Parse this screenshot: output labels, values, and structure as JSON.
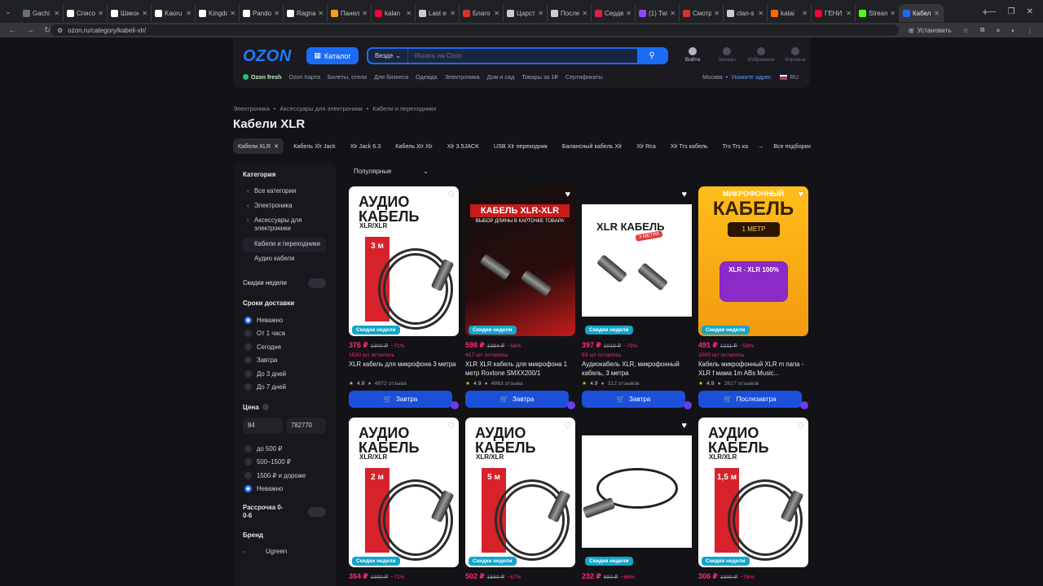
{
  "browser": {
    "tabs": [
      {
        "title": "Gachi",
        "color": "#6a6e7a"
      },
      {
        "title": "Списо",
        "color": "#ffffff"
      },
      {
        "title": "Шикон",
        "color": "#ffffff"
      },
      {
        "title": "Kaoru",
        "color": "#ffffff"
      },
      {
        "title": "Kingdo",
        "color": "#ffffff"
      },
      {
        "title": "Pando",
        "color": "#ffffff"
      },
      {
        "title": "Ragna",
        "color": "#ffffff"
      },
      {
        "title": "Панел",
        "color": "#f4a01c"
      },
      {
        "title": "kalan",
        "color": "#ff0033"
      },
      {
        "title": "Last e",
        "color": "#cccccc"
      },
      {
        "title": "Благо",
        "color": "#d8302f"
      },
      {
        "title": "Царст",
        "color": "#cccccc"
      },
      {
        "title": "После",
        "color": "#cccccc"
      },
      {
        "title": "Серде",
        "color": "#e0204a"
      },
      {
        "title": "(1) Twi",
        "color": "#9146ff"
      },
      {
        "title": "Смотр",
        "color": "#d8302f"
      },
      {
        "title": "clan-s",
        "color": "#cccccc"
      },
      {
        "title": "katai",
        "color": "#ff6a00"
      },
      {
        "title": "ГЕНИ",
        "color": "#ff0033"
      },
      {
        "title": "Stream",
        "color": "#53fc18"
      },
      {
        "title": "Кабел",
        "color": "#1c6bf5",
        "active": true
      }
    ],
    "url": "ozon.ru/category/kabeli-xlr/",
    "install_label": "Установить"
  },
  "header": {
    "logo": "OZON",
    "catalog_label": "Каталог",
    "search_scope": "Везде",
    "search_placeholder": "Искать на Ozon",
    "icons": [
      {
        "label": "Войти",
        "icon": "user-icon",
        "active": true
      },
      {
        "label": "Заказы",
        "icon": "box-icon"
      },
      {
        "label": "Избранное",
        "icon": "heart-icon"
      },
      {
        "label": "Корзина",
        "icon": "cart-icon"
      }
    ],
    "subnav": [
      "Ozon fresh",
      "Ozon Карта",
      "Билеты, отели",
      "Для бизнеса",
      "Одежда",
      "Электроника",
      "Дом и сад",
      "Товары за 1₽",
      "Сертификаты"
    ],
    "city": "Москва",
    "address_link": "Укажите адрес",
    "lang": "RU"
  },
  "breadcrumb": [
    "Электроника",
    "Аксессуары для электроники",
    "Кабели и переходники"
  ],
  "page_title": "Кабели XLR",
  "chips": [
    "Кабели XLR",
    "Кабель Xlr Jack",
    "Xlr Jack 6.3",
    "Кабель Xlr Xlr",
    "Xlr 3.5JACK",
    "USB Xlr переходник",
    "Балансный кабель Xlr",
    "Xlr Rca",
    "Xlr Trs кабель",
    "Trs Trs ка",
    "Все подборки"
  ],
  "sidebar": {
    "category_title": "Категория",
    "categories": [
      "Все категории",
      "Электроника",
      "Аксессуары для электроники",
      "Кабели и переходники",
      "Аудио кабели"
    ],
    "week_deals": "Скидки недели",
    "delivery_title": "Сроки доставки",
    "delivery": [
      "Неважно",
      "От 1 часа",
      "Сегодня",
      "Завтра",
      "До 3 дней",
      "До 7 дней"
    ],
    "price_title": "Цена",
    "price_from": "84",
    "price_to": "782770",
    "price_ranges": [
      "до 500 ₽",
      "500–1500 ₽",
      "1500 ₽ и дороже",
      "Неважно"
    ],
    "installment": "Рассрочка 0-0-6",
    "brand_title": "Бренд",
    "brand_first": "Ugreen"
  },
  "sort_label": "Популярные",
  "badge_label": "Скидки недели",
  "products": [
    {
      "price": "376 ₽",
      "old": "1300 ₽",
      "disc": "−71%",
      "left": "1530 шт осталось",
      "name": "XLR кабель для микрофона 3 метра",
      "rating": "4.9",
      "reviews": "4972 отзыва",
      "btn": "Завтра",
      "img": "audio",
      "len": "3 м"
    },
    {
      "price": "598 ₽",
      "old": "1384 ₽",
      "disc": "−56%",
      "left": "417 шт осталось",
      "name": "XLR XLR кабель для микрофона 1 метр Roxtone SMXX200/1",
      "rating": "4.9",
      "reviews": "4863 отзыва",
      "btn": "Завтра",
      "img": "roxtone",
      "banner": "КАБЕЛЬ XLR-XLR",
      "banner_sub": "ВЫБОР ДЛИНЫ В КАРТОЧКЕ ТОВАРА"
    },
    {
      "price": "397 ₽",
      "old": "1918 ₽",
      "disc": "−79%",
      "left": "53 шт осталось",
      "name": "Аудиокабель XLR, микрофонный кабель, 3 метра",
      "rating": "4.9",
      "reviews": "312 отзывов",
      "btn": "Завтра",
      "img": "xlr3",
      "label": "XLR КАБЕЛЬ",
      "sub": "3 МЕТРА"
    },
    {
      "price": "491 ₽",
      "old": "1211 ₽",
      "disc": "−59%",
      "left": "1000 шт осталось",
      "name": "Кабель микрофонный XLR m папа - XLR f мама 1m ABs Music...",
      "rating": "4.9",
      "reviews": "2617 отзывов",
      "btn": "Послезавтра",
      "img": "yellow",
      "top": "МИКРОФОННЫЙ",
      "big": "КАБЕЛЬ",
      "tag": "1 МЕТР",
      "purple": "XLR - XLR 100%"
    },
    {
      "price": "364 ₽",
      "old": "1300 ₽",
      "disc": "−72%",
      "left": "",
      "name": "",
      "rating": "",
      "reviews": "",
      "btn": "",
      "img": "audio",
      "len": "2 м"
    },
    {
      "price": "502 ₽",
      "old": "1550 ₽",
      "disc": "−67%",
      "left": "",
      "name": "",
      "rating": "",
      "reviews": "",
      "btn": "",
      "img": "audio",
      "len": "5 м"
    },
    {
      "price": "232 ₽",
      "old": "690 ₽",
      "disc": "−66%",
      "left": "",
      "name": "",
      "rating": "",
      "reviews": "",
      "btn": "",
      "img": "plain"
    },
    {
      "price": "306 ₽",
      "old": "1300 ₽",
      "disc": "−76%",
      "left": "",
      "name": "",
      "rating": "",
      "reviews": "",
      "btn": "",
      "img": "audio",
      "len": "1,5 м"
    }
  ],
  "audio_img_title": "АУДИО КАБЕЛЬ",
  "audio_img_sub": "XLR/XLR"
}
